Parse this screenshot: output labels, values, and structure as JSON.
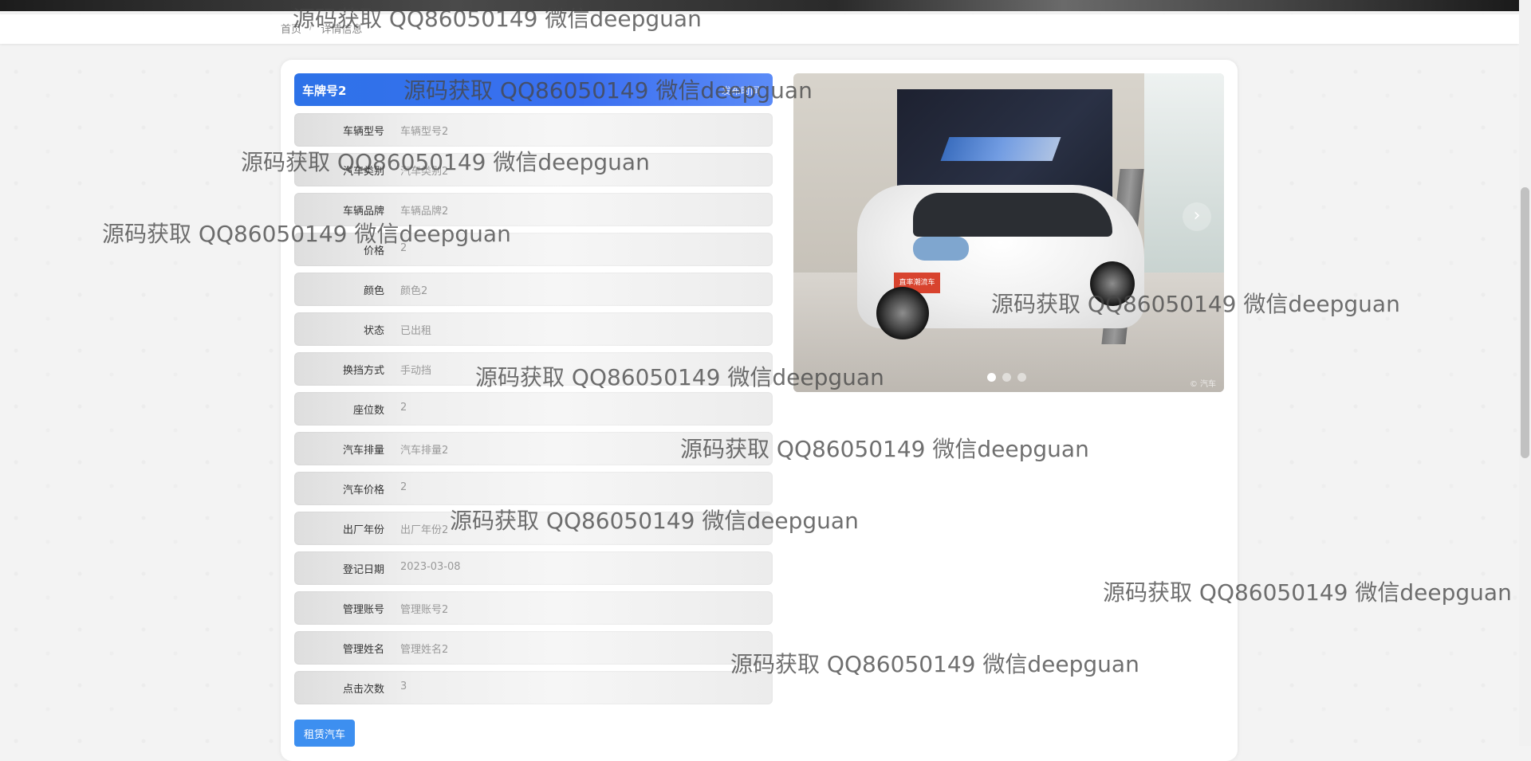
{
  "breadcrumb": {
    "home": "首页",
    "current": "详情信息"
  },
  "detail": {
    "title": "车牌号2",
    "meta": "发布时间",
    "rent_button": "租赁汽车",
    "fields": [
      {
        "label": "车辆型号",
        "value": "车辆型号2"
      },
      {
        "label": "汽车类别",
        "value": "汽车类别2"
      },
      {
        "label": "车辆品牌",
        "value": "车辆品牌2"
      },
      {
        "label": "价格",
        "value": "2"
      },
      {
        "label": "颜色",
        "value": "颜色2"
      },
      {
        "label": "状态",
        "value": "已出租"
      },
      {
        "label": "换挡方式",
        "value": "手动挡"
      },
      {
        "label": "座位数",
        "value": "2"
      },
      {
        "label": "汽车排量",
        "value": "汽车排量2"
      },
      {
        "label": "汽车价格",
        "value": "2"
      },
      {
        "label": "出厂年份",
        "value": "出厂年份2"
      },
      {
        "label": "登记日期",
        "value": "2023-03-08"
      },
      {
        "label": "管理账号",
        "value": "管理账号2"
      },
      {
        "label": "管理姓名",
        "value": "管理姓名2"
      },
      {
        "label": "点击次数",
        "value": "3"
      }
    ]
  },
  "carousel": {
    "next_icon": "chevron-right-icon",
    "next_glyph": "›",
    "slide_count": 3,
    "active_index": 0,
    "plate_text": "直率潮流车",
    "photo_mark": "© 汽车"
  },
  "watermark": {
    "text": "源码获取 QQ86050149 微信deepguan"
  },
  "colors": {
    "accent": "#3b6ff0",
    "button": "#3d8ff0"
  }
}
